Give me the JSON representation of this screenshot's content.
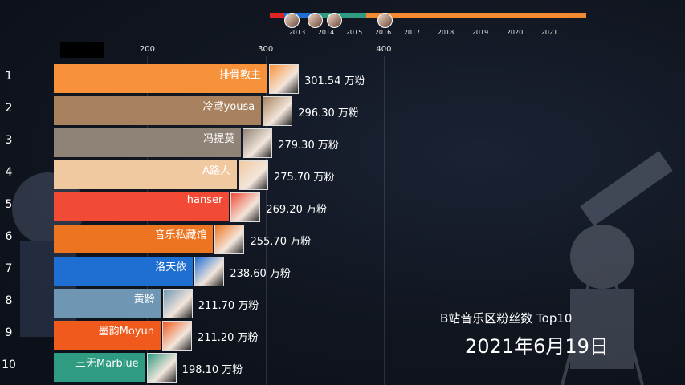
{
  "chart_data": {
    "type": "bar",
    "title": "B站音乐区粉丝数 Top10",
    "date": "2021年6月19日",
    "unit_suffix": "万粉",
    "x_ticks": [
      200,
      300,
      400
    ],
    "xlim": [
      120,
      420
    ],
    "ranks": [
      "1",
      "2",
      "3",
      "4",
      "5",
      "6",
      "7",
      "8",
      "9",
      "10"
    ],
    "categories": [
      "排骨教主",
      "冷鸢yousa",
      "冯提莫",
      "A路人",
      "hanser",
      "音乐私藏馆",
      "洛天依",
      "黄龄",
      "墨韵Moyun",
      "三无Marblue"
    ],
    "values": [
      301.54,
      296.3,
      279.3,
      275.7,
      269.2,
      255.7,
      238.6,
      211.7,
      211.2,
      198.1
    ],
    "value_labels": [
      "301.54 万粉",
      "296.30 万粉",
      "279.30 万粉",
      "275.70 万粉",
      "269.20 万粉",
      "255.70 万粉",
      "238.60 万粉",
      "211.70 万粉",
      "211.20 万粉",
      "198.10 万粉"
    ],
    "colors": [
      "#f7923a",
      "#a8825e",
      "#8f8276",
      "#f1c9a0",
      "#f14b36",
      "#ed7420",
      "#1f6fd3",
      "#6f97b3",
      "#f05a1d",
      "#2f9c82"
    ],
    "timeline": {
      "years": [
        "2013",
        "2014",
        "2015",
        "2016",
        "2017",
        "2018",
        "2019",
        "2020",
        "2021"
      ],
      "segment_colors": [
        "#e02424",
        "#1f6fd3",
        "#2f9c82",
        "#f28a30"
      ]
    }
  }
}
